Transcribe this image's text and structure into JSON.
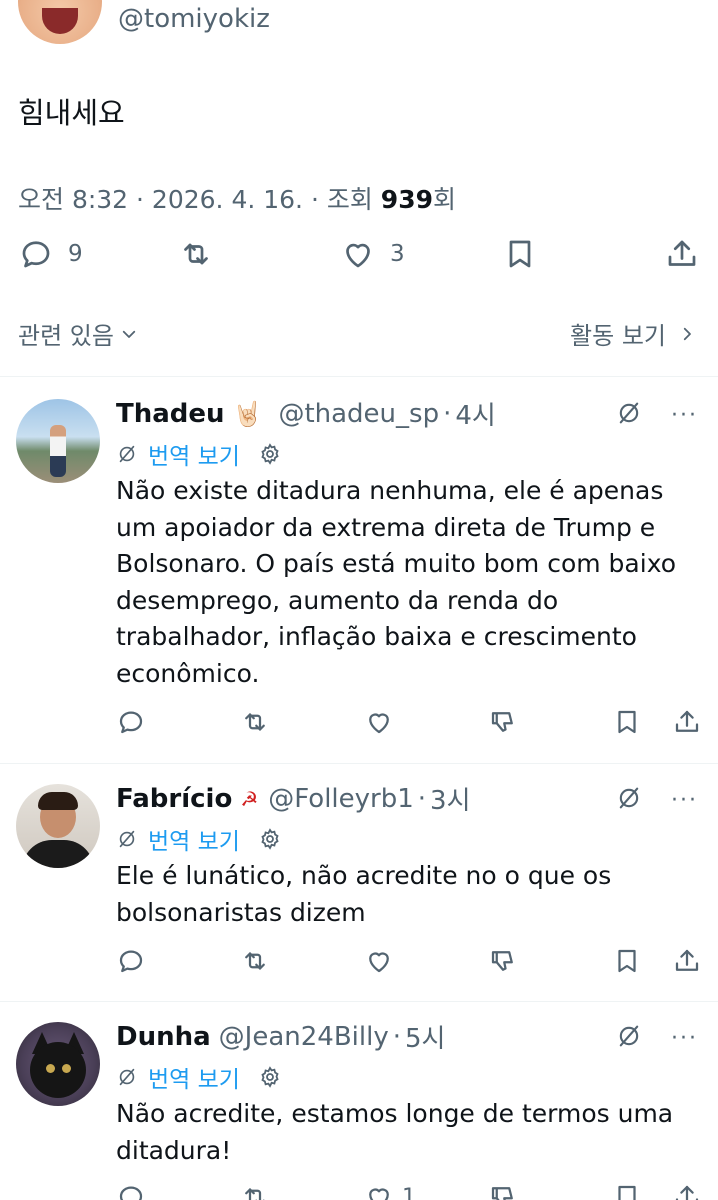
{
  "tweet": {
    "handle": "@tomiyokiz",
    "text": "힘내세요",
    "meta_prefix": "오전 8:32 · 2026. 4. 16. · 조회 ",
    "views": "939",
    "meta_suffix": "회",
    "actions": {
      "reply_count": "9",
      "retweet_count": "",
      "like_count": "3"
    }
  },
  "related_label": "관련 있음",
  "activity_label": "활동 보기",
  "replies": [
    {
      "name": "Thadeu",
      "emoji": "🤘🏻",
      "handle": "@thadeu_sp",
      "time": "4시",
      "translate_label": "번역 보기",
      "text": "Não existe ditadura nenhuma, ele é apenas um apoiador da extrema direta de Trump e Bolsonaro.  O país está muito bom com baixo desemprego, aumento da renda do trabalhador, inflação baixa e crescimento econômico.",
      "like_count": ""
    },
    {
      "name": "Fabrício",
      "emoji": "☭",
      "handle": "@Folleyrb1",
      "time": "3시",
      "translate_label": "번역 보기",
      "text": "Ele é lunático, não acredite no o que os bolsonaristas dizem",
      "like_count": ""
    },
    {
      "name": "Dunha",
      "emoji": "",
      "handle": "@Jean24Billy",
      "time": "5시",
      "translate_label": "번역 보기",
      "text": "Não acredite, estamos longe de termos uma ditadura!",
      "like_count": "1"
    }
  ],
  "colors": {
    "text": "#0f1419",
    "secondary": "#536471",
    "link": "#1d9bf0",
    "divider": "#eff3f4"
  },
  "icons": [
    "reply-icon",
    "retweet-icon",
    "like-icon",
    "bookmark-icon",
    "share-icon",
    "dislike-icon",
    "hide-icon",
    "more-icon",
    "translate-icon",
    "gear-icon",
    "chevron-down-icon",
    "chevron-right-icon"
  ]
}
